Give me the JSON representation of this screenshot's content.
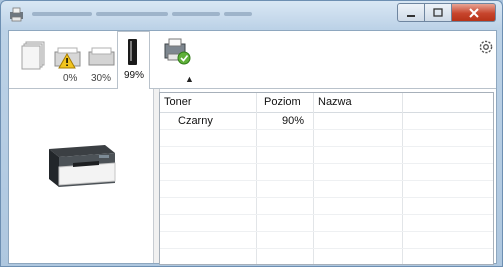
{
  "window": {
    "title": ""
  },
  "toolbar": {
    "tabs": [
      {
        "id": "paper",
        "icon": "paper-stack-icon",
        "label": ""
      },
      {
        "id": "tray1",
        "icon": "paper-tray-warning-icon",
        "label": "0%"
      },
      {
        "id": "tray2",
        "icon": "paper-tray-icon",
        "label": "30%"
      },
      {
        "id": "toner",
        "icon": "toner-cartridge-icon",
        "label": "99%"
      },
      {
        "id": "status",
        "icon": "printer-status-icon",
        "label": ""
      }
    ],
    "selected_tab": "toner"
  },
  "table": {
    "headers": [
      "Toner",
      "Poziom",
      "Nazwa"
    ],
    "rows": [
      {
        "toner": "Czarny",
        "level": "90%",
        "name": ""
      }
    ]
  }
}
